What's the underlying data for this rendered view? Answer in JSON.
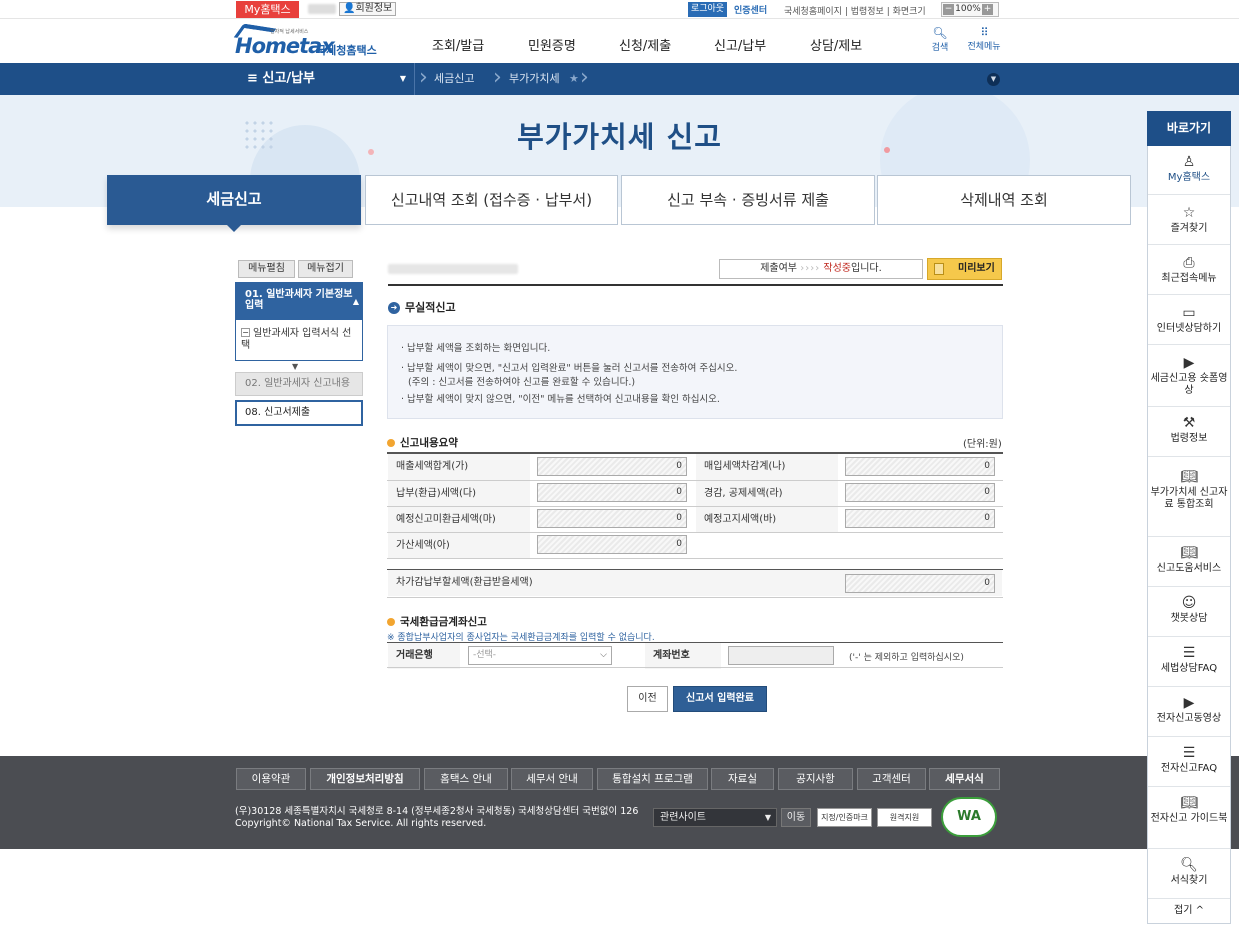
{
  "topbar": {
    "my_home": "My홈택스",
    "member_info": "회원정보",
    "logout": "로그아웃",
    "cert_center": "인증센터",
    "links": "국세청홈페이지 | 법령정보 | 화면크기",
    "zoom_minus": "−",
    "zoom": "100%",
    "zoom_plus": "+"
  },
  "header": {
    "logo_home": "Hometax",
    "logo_sub": "전자적 납세서비스",
    "logo_nts": "국세청홈택스",
    "gnb": [
      "조회/발급",
      "민원증명",
      "신청/제출",
      "신고/납부",
      "상담/제보"
    ],
    "search": "검색",
    "all_menu": "전체메뉴"
  },
  "breadcrumb": {
    "menu": "신고/납부",
    "items": [
      "세금신고",
      "부가가치세"
    ]
  },
  "page_title": "부가가치세 신고",
  "tabs": [
    "세금신고",
    "신고내역 조회 (접수증 · 납부서)",
    "신고 부속 · 증빙서류 제출",
    "삭제내역 조회"
  ],
  "left_menu": {
    "expand": "메뉴펼침",
    "collapse": "메뉴접기",
    "step1": "01. 일반과세자 기본정보 입력",
    "step1_sub": "일반과세자 입력서식 선택",
    "step2": "02. 일반과세자 신고내용",
    "step3": "08. 신고서제출"
  },
  "status": {
    "label": "제출여부",
    "arrows": "››››",
    "state": "작성중",
    "suffix": "입니다.",
    "preview": "미리보기"
  },
  "section_title": "무실적신고",
  "info_lines": [
    "· 납부할 세액을 조회하는 화면입니다.",
    "· 납부할 세액이 맞으면, \"신고서 입력완료\" 버튼을 눌러 신고서를 전송하여 주십시오.",
    "  (주의 : 신고서를 전송하여야 신고를 완료할 수 있습니다.)",
    "· 납부할 세액이 맞지 않으면, \"이전\" 메뉴를 선택하여 신고내용을 확인 하십시오."
  ],
  "summary": {
    "title": "신고내용요약",
    "unit": "(단위:원)",
    "rows": [
      {
        "l1": "매출세액합계(가)",
        "v1": "0",
        "l2": "매입세액차감계(나)",
        "v2": "0"
      },
      {
        "l1": "납부(환급)세액(다)",
        "v1": "0",
        "l2": "경감, 공제세액(라)",
        "v2": "0"
      },
      {
        "l1": "예정신고미환급세액(마)",
        "v1": "0",
        "l2": "예정고지세액(바)",
        "v2": "0"
      },
      {
        "l1": "가산세액(아)",
        "v1": "0"
      }
    ],
    "total_label": "차가감납부할세액(환급받을세액)",
    "total_value": "0"
  },
  "account": {
    "title": "국세환급금계좌신고",
    "note": "※ 종합납부사업자의 종사업자는 국세환급금계좌를 입력할 수 없습니다.",
    "bank_label": "거래은행",
    "bank_placeholder": "-선택-",
    "acct_label": "계좌번호",
    "acct_hint": "('-' 는 제외하고 입력하십시오)"
  },
  "buttons": {
    "prev": "이전",
    "done": "신고서 입력완료"
  },
  "footer": {
    "links": [
      "이용약관",
      "개인정보처리방침",
      "홈택스 안내",
      "세무서 안내",
      "통합설치 프로그램",
      "자료실",
      "공지사항",
      "고객센터",
      "세무서식"
    ],
    "address": "(우)30128 세종특별자치시 국세청로 8-14 (정부세종2청사 국세청동) 국세청상담센터 국번없이 126",
    "copyright": "Copyright© National Tax Service. All rights reserved.",
    "related": "관련사이트",
    "move": "이동",
    "badge1": "지정/인증마크",
    "badge2": "원격지원",
    "wa": "WA"
  },
  "quick": {
    "title": "바로가기",
    "items": [
      "My홈택스",
      "즐겨찾기",
      "최근접속메뉴",
      "인터넷상담하기",
      "세금신고용 숏폼영상",
      "법령정보",
      "부가가치세 신고자료 통합조회",
      "신고도움서비스",
      "챗봇상담",
      "세법상담FAQ",
      "전자신고동영상",
      "전자신고FAQ",
      "전자신고 가이드북",
      "서식찾기"
    ],
    "fold": "접기 ^"
  }
}
